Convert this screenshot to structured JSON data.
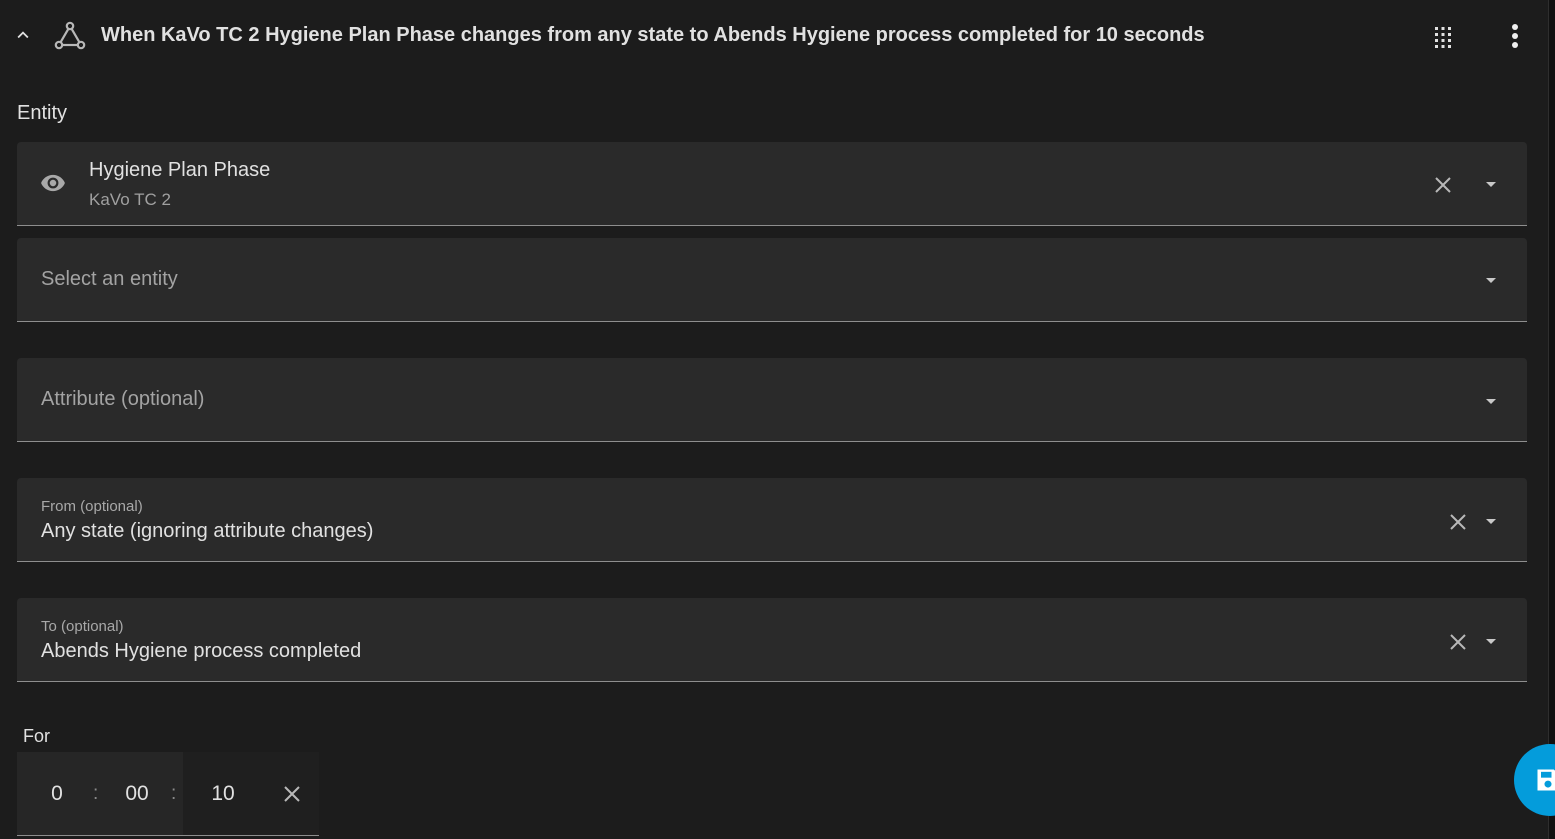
{
  "header": {
    "title": "When KaVo TC 2 Hygiene Plan Phase changes from any state to Abends Hygiene process completed for 10 seconds"
  },
  "entity_section": {
    "label": "Entity",
    "selected": {
      "name": "Hygiene Plan Phase",
      "device": "KaVo TC 2"
    },
    "add_placeholder": "Select an entity"
  },
  "attribute": {
    "placeholder": "Attribute (optional)"
  },
  "from": {
    "label": "From (optional)",
    "value": "Any state (ignoring attribute changes)"
  },
  "to": {
    "label": "To (optional)",
    "value": "Abends Hygiene process completed"
  },
  "for": {
    "label": "For",
    "hours": "0",
    "minutes": "00",
    "seconds": "10",
    "separator": ":"
  },
  "icons": {
    "collapse": "chevron-up-icon",
    "trigger": "state-trigger-icon",
    "drag": "drag-grid-icon",
    "menu": "more-vertical-icon",
    "entity": "eye-icon",
    "clear": "close-icon",
    "dropdown": "menu-down-icon",
    "save": "save-icon"
  },
  "colors": {
    "accent": "#049cdb",
    "field_bg": "#2a2a2a",
    "card_bg": "#1c1c1c"
  }
}
